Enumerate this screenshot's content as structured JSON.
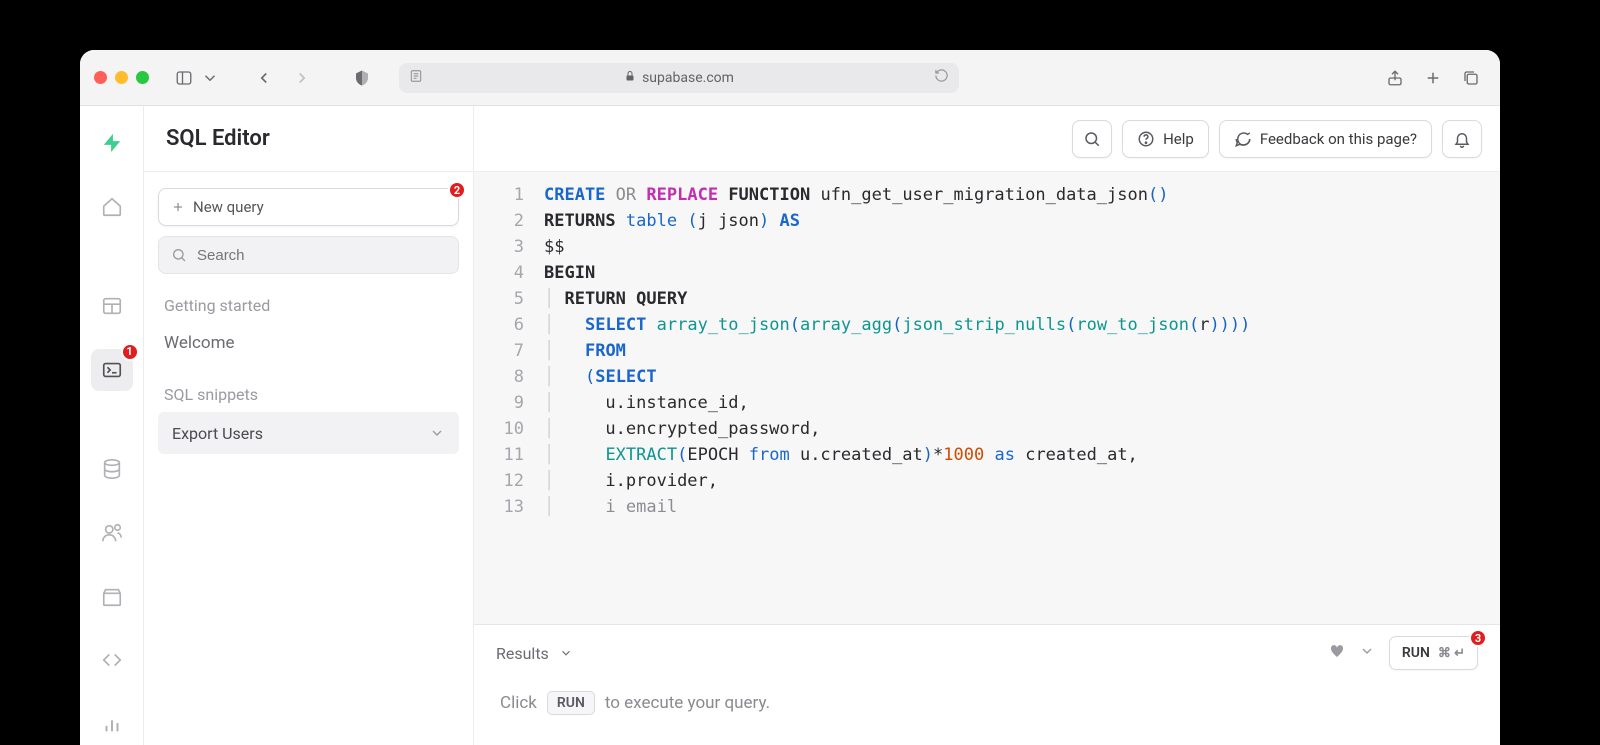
{
  "browser": {
    "address": "supabase.com"
  },
  "header": {
    "title": "SQL Editor",
    "search_icon_label": "Search",
    "help_label": "Help",
    "feedback_label": "Feedback on this page?"
  },
  "sidebar": {
    "new_query_label": "New query",
    "search_placeholder": "Search",
    "getting_started_title": "Getting started",
    "welcome_label": "Welcome",
    "snippets_title": "SQL snippets",
    "snippets": [
      {
        "label": "Export Users"
      }
    ]
  },
  "annotations": {
    "badge1": "1",
    "badge2": "2",
    "badge3": "3"
  },
  "code": {
    "lines": [
      {
        "n": "1",
        "t": "<span class='kw-create'>CREATE</span> <span class='kw-or'>OR</span> <span class='kw-replace'>REPLACE</span> <span class='kw-func'>FUNCTION</span> ufn_get_user_migration_data_json<span class='paren'>()</span>"
      },
      {
        "n": "2",
        "t": "<span class='kw-func'>RETURNS</span> <span class='kw-blue'>table</span> <span class='paren'>(</span>j json<span class='paren'>)</span> <span class='kw-as'>AS</span>"
      },
      {
        "n": "3",
        "t": "$$"
      },
      {
        "n": "4",
        "t": "<span class='kw-func'>BEGIN</span>"
      },
      {
        "n": "5",
        "t": "<span class='indent-guide'>│</span> <span class='kw-func'>RETURN QUERY</span>"
      },
      {
        "n": "6",
        "t": "<span class='indent-guide'>│</span>   <span class='kw-create'>SELECT</span> <span class='fn-teal'>array_to_json</span><span class='paren'>(</span><span class='fn-teal'>array_agg</span><span class='paren'>(</span><span class='fn-teal'>json_strip_nulls</span><span class='paren'>(</span><span class='fn-teal'>row_to_json</span><span class='paren'>(</span>r<span class='paren'>))))</span>"
      },
      {
        "n": "7",
        "t": "<span class='indent-guide'>│</span>   <span class='kw-create'>FROM</span>"
      },
      {
        "n": "8",
        "t": "<span class='indent-guide'>│</span>   <span class='paren'>(</span><span class='kw-create'>SELECT</span>"
      },
      {
        "n": "9",
        "t": "<span class='indent-guide'>│</span>     u.instance_id,"
      },
      {
        "n": "10",
        "t": "<span class='indent-guide'>│</span>     u.encrypted_password,"
      },
      {
        "n": "11",
        "t": "<span class='indent-guide'>│</span>     <span class='fn-teal'>EXTRACT</span><span class='paren'>(</span>EPOCH <span class='kw-from-epoch'>from</span> u.created_at<span class='paren'>)</span>*<span class='num'>1000</span> <span class='kw-blue'>as</span> created_at,"
      },
      {
        "n": "12",
        "t": "<span class='indent-guide'>│</span>     i.provider,"
      },
      {
        "n": "13",
        "t": "<span class='lastline'><span class='indent-guide'>│</span>     i email</span>"
      }
    ]
  },
  "results": {
    "tab_label": "Results",
    "run_label": "RUN",
    "run_shortcut": "⌘ ↵",
    "hint_prefix": "Click",
    "hint_chip": "RUN",
    "hint_suffix": "to execute your query."
  }
}
